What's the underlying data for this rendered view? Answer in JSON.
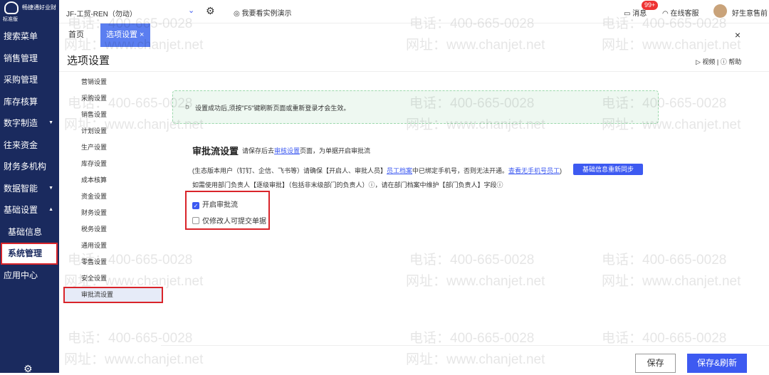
{
  "app": {
    "brand": "畅捷通好业财",
    "edition": "标准版"
  },
  "sidebar": {
    "items": [
      {
        "label": "搜索菜单",
        "caret": ""
      },
      {
        "label": "销售管理",
        "caret": ""
      },
      {
        "label": "采购管理",
        "caret": ""
      },
      {
        "label": "库存核算",
        "caret": ""
      },
      {
        "label": "数字制造",
        "caret": "▼"
      },
      {
        "label": "往来资金",
        "caret": ""
      },
      {
        "label": "财务多机构",
        "caret": ""
      },
      {
        "label": "数据智能",
        "caret": "▼"
      },
      {
        "label": "基础设置",
        "caret": "▲"
      },
      {
        "label": "基础信息",
        "caret": ""
      },
      {
        "label": "系统管理",
        "caret": ""
      },
      {
        "label": "应用中心",
        "caret": ""
      }
    ]
  },
  "topbar": {
    "company": "JF-工贸-REN（勿动）",
    "demo": "我要看实例演示",
    "messages": "消息",
    "messages_badge": "99+",
    "service": "在线客服",
    "user": "好生意售前"
  },
  "tabs": {
    "home": "首页",
    "current": "选项设置 ×",
    "close": "×"
  },
  "page": {
    "title": "选项设置",
    "help": "视频 | ⓘ 帮助"
  },
  "settings_menu": [
    "营销设置",
    "采购设置",
    "销售设置",
    "计划设置",
    "生产设置",
    "库存设置",
    "成本核算",
    "资金设置",
    "财务设置",
    "税务设置",
    "通用设置",
    "零售设置",
    "安全设置",
    "审批流设置"
  ],
  "notice": "设置成功后,须按\"F5\"键刷新页面或重新登录才会生效。",
  "approval": {
    "title": "审批流设置",
    "desc_pre": "请保存后去",
    "desc_link": "审核设置",
    "desc_post": "页面，为单据开启审批流",
    "line1_pre": "(生态版本用户（钉钉、企信、飞书等）请确保【开启人、审批人员】",
    "line1_link": "员工档案",
    "line1_mid": "中已绑定手机号，否则无法开通。",
    "line1_link2": "查看无手机号员工",
    "line1_post": ")",
    "sync_button": "基础信息重新同步",
    "line2": "如需使用部门负责人【逐级审批】（包括非末级部门的负责人）ⓘ，请在部门档案中维护【部门负责人】字段ⓘ",
    "cb1": "开启审批流",
    "cb1_checked": true,
    "cb2": "仅修改人可提交单据",
    "cb2_checked": false
  },
  "buttons": {
    "save": "保存",
    "save_refresh": "保存&刷新"
  },
  "watermark": {
    "phone": "电话：400-665-0028",
    "site": "网址：www.chanjet.net"
  }
}
